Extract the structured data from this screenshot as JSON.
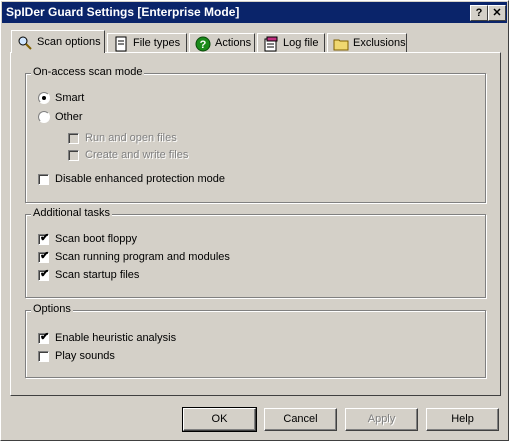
{
  "window": {
    "title": "SpIDer Guard Settings [Enterprise Mode]",
    "help_glyph": "?",
    "close_glyph": "✕"
  },
  "tabs": [
    {
      "label": "Scan options",
      "icon": "magnifier-icon",
      "active": true
    },
    {
      "label": "File types",
      "icon": "document-icon"
    },
    {
      "label": "Actions",
      "icon": "question-icon"
    },
    {
      "label": "Log file",
      "icon": "notepad-icon"
    },
    {
      "label": "Exclusions",
      "icon": "folder-icon"
    }
  ],
  "on_access": {
    "title": "On-access scan mode",
    "smart": {
      "label": "Smart",
      "selected": true
    },
    "other": {
      "label": "Other",
      "selected": false
    },
    "run_open": {
      "label": "Run and open files",
      "checked": false,
      "enabled": false
    },
    "create_write": {
      "label": "Create and write files",
      "checked": false,
      "enabled": false
    },
    "disable_enhanced": {
      "label": "Disable enhanced protection mode",
      "checked": false
    }
  },
  "additional": {
    "title": "Additional tasks",
    "items": [
      {
        "label": "Scan boot floppy",
        "checked": true
      },
      {
        "label": "Scan running program and modules",
        "checked": true
      },
      {
        "label": "Scan startup files",
        "checked": true
      }
    ]
  },
  "options": {
    "title": "Options",
    "items": [
      {
        "label": "Enable heuristic analysis",
        "checked": true
      },
      {
        "label": "Play sounds",
        "checked": false
      }
    ]
  },
  "buttons": {
    "ok": "OK",
    "cancel": "Cancel",
    "apply": "Apply",
    "help": "Help"
  },
  "check_mark": "✔"
}
